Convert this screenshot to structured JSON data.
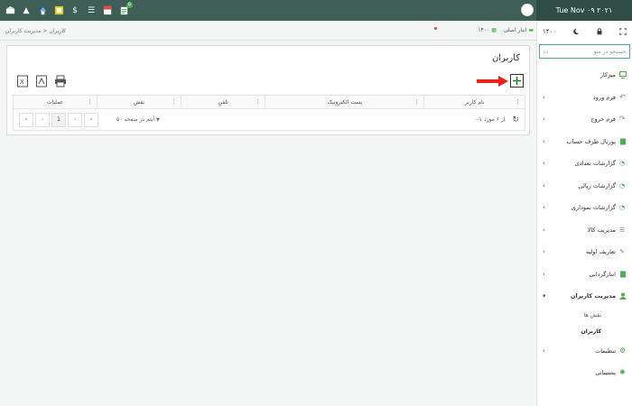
{
  "topbar": {
    "date": "Tue Nov ۰۹ ۲۰۲۱",
    "badges": {
      "sms": "۵"
    }
  },
  "sidebar": {
    "year": "۱۴۰۰",
    "search_placeholder": "جستجو در منو",
    "items": [
      {
        "label": "میزکار",
        "icon": "monitor-icon"
      },
      {
        "label": "فرم ورود",
        "icon": "undo-icon"
      },
      {
        "label": "فرم خروج",
        "icon": "redo-icon"
      },
      {
        "label": "پورتال طرف حساب",
        "icon": "file-icon"
      },
      {
        "label": "گزارشات تعدادی",
        "icon": "chart-icon"
      },
      {
        "label": "گزارشات ریالی",
        "icon": "chart-icon"
      },
      {
        "label": "گزارشات نموداری",
        "icon": "chart-icon"
      },
      {
        "label": "مدیریت کالا",
        "icon": "list-icon"
      },
      {
        "label": "تعاریف اولیه",
        "icon": "edit-icon"
      },
      {
        "label": "انبارگردانی",
        "icon": "file-icon"
      },
      {
        "label": "مدیریت کاربران",
        "icon": "user-icon"
      },
      {
        "label": "تنظیمات",
        "icon": "cogs-icon"
      },
      {
        "label": "پشتیبانی",
        "icon": "support-icon"
      }
    ],
    "sub_items": [
      "نقش ها",
      "کاربران"
    ]
  },
  "breadcrumb": {
    "current": "کاربران",
    "parent": "مدیریت کاربران"
  },
  "header": {
    "warehouse": "انبار اصلی",
    "year": "۱۴۰۰"
  },
  "panel": {
    "title": "کاربران",
    "columns": [
      "عملیات",
      "نقش",
      "تلفن",
      "پست الکترونیک",
      "نام کاربر"
    ],
    "pager": {
      "current_page": "1",
      "per_page_value": "۵۰",
      "per_page_label": "آیتم در صفحه",
      "range": "۰-۱ از ۶ مورد"
    }
  },
  "colors": {
    "topbar": "#3e5e57",
    "accent": "#4caf50",
    "arrow": "#e8231b"
  }
}
